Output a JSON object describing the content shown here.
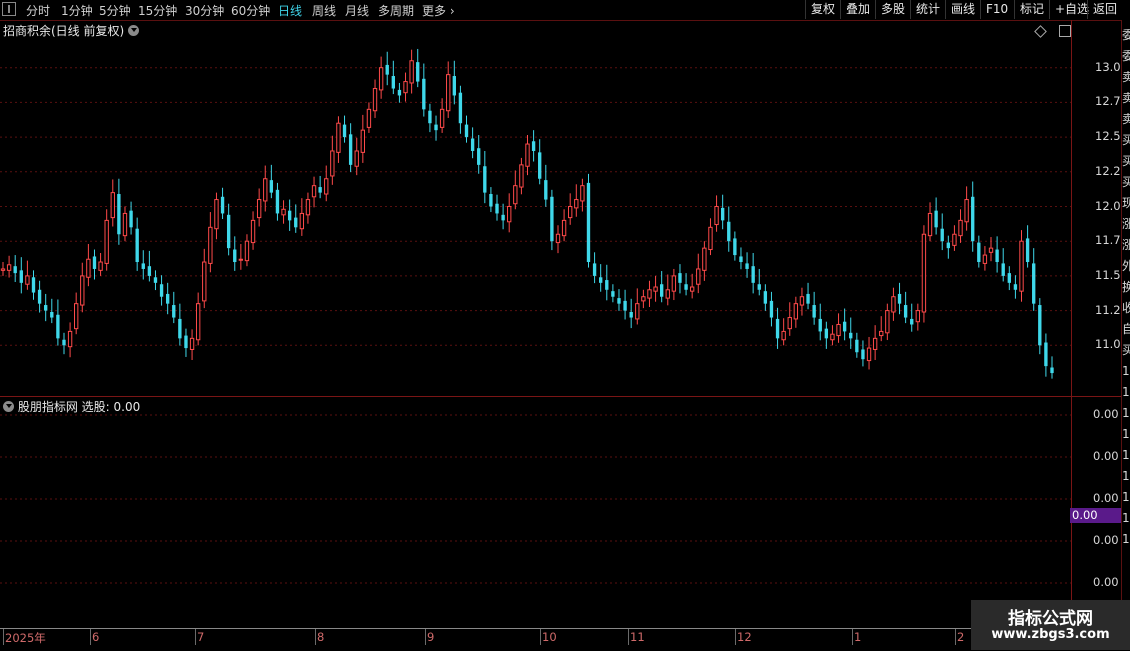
{
  "toolbar": {
    "periods": [
      "分时",
      "1分钟",
      "5分钟",
      "15分钟",
      "30分钟",
      "60分钟",
      "日线",
      "周线",
      "月线",
      "多周期",
      "更多"
    ],
    "active_period": "日线",
    "tools": [
      "复权",
      "叠加",
      "多股",
      "统计",
      "画线",
      "F10",
      "标记",
      "+自选",
      "返回"
    ]
  },
  "main_chart": {
    "title": "招商积余(日线 前复权)",
    "price_ticks": [
      "13.00",
      "12.75",
      "12.50",
      "12.25",
      "12.00",
      "11.75",
      "11.50",
      "11.25",
      "11.00"
    ]
  },
  "indicator": {
    "title": "股朋指标网 选股: 0.00",
    "ticks": [
      "0.00",
      "0.00",
      "0.00",
      "0.00",
      "0.00"
    ],
    "current_value": "0.00"
  },
  "date_axis": {
    "labels": [
      "2025年",
      "6",
      "7",
      "8",
      "9",
      "10",
      "11",
      "12",
      "1",
      "2"
    ]
  },
  "right_strip": {
    "chars": [
      "委",
      "委",
      "卖",
      "卖",
      "卖",
      "买",
      "买",
      "买",
      "现",
      "涨",
      "涨",
      "外",
      "换",
      "收",
      "自",
      "买",
      "1",
      "1",
      "1",
      "1",
      "1",
      "1",
      "1",
      "1",
      "1"
    ]
  },
  "watermark": {
    "title": "指标公式网",
    "url": "www.zbgs3.com"
  },
  "colors": {
    "up": "#ff4a4a",
    "down": "#3fd8ea",
    "grid": "#5a1010",
    "badge": "#5a1a8a"
  },
  "chart_data": {
    "type": "candlestick",
    "y_range": [
      10.75,
      13.25
    ],
    "x_labels": [
      "2025年",
      "6",
      "7",
      "8",
      "9",
      "10",
      "11",
      "12",
      "1",
      "2"
    ],
    "close_series": [
      11.55,
      11.58,
      11.52,
      11.45,
      11.5,
      11.38,
      11.3,
      11.25,
      11.2,
      11.05,
      11.0,
      11.1,
      11.3,
      11.5,
      11.62,
      11.55,
      11.6,
      11.9,
      12.1,
      11.8,
      11.95,
      11.85,
      11.6,
      11.55,
      11.5,
      11.45,
      11.35,
      11.3,
      11.2,
      11.05,
      10.98,
      11.05,
      11.3,
      11.6,
      11.85,
      12.05,
      11.95,
      11.7,
      11.6,
      11.62,
      11.75,
      11.9,
      12.05,
      12.2,
      12.1,
      11.95,
      11.98,
      11.9,
      11.85,
      11.95,
      12.05,
      12.15,
      12.1,
      12.2,
      12.4,
      12.6,
      12.5,
      12.3,
      12.4,
      12.55,
      12.7,
      12.85,
      13.0,
      12.95,
      12.85,
      12.8,
      12.9,
      13.05,
      12.9,
      12.7,
      12.6,
      12.55,
      12.7,
      12.95,
      12.8,
      12.6,
      12.5,
      12.4,
      12.3,
      12.1,
      12.0,
      11.95,
      11.9,
      12.0,
      12.15,
      12.3,
      12.45,
      12.4,
      12.2,
      12.05,
      11.75,
      11.8,
      11.9,
      12.0,
      12.05,
      12.15,
      11.6,
      11.5,
      11.45,
      11.4,
      11.35,
      11.3,
      11.25,
      11.2,
      11.3,
      11.35,
      11.4,
      11.42,
      11.35,
      11.4,
      11.5,
      11.45,
      11.4,
      11.42,
      11.55,
      11.7,
      11.85,
      12.0,
      11.9,
      11.75,
      11.65,
      11.6,
      11.55,
      11.45,
      11.4,
      11.3,
      11.2,
      11.05,
      11.1,
      11.2,
      11.3,
      11.35,
      11.3,
      11.2,
      11.1,
      11.05,
      11.08,
      11.15,
      11.1,
      11.05,
      10.95,
      10.9,
      10.98,
      11.05,
      11.1,
      11.25,
      11.35,
      11.3,
      11.2,
      11.15,
      11.25,
      11.8,
      11.95,
      11.85,
      11.75,
      11.7,
      11.8,
      11.9,
      12.05,
      11.75,
      11.6,
      11.65,
      11.7,
      11.6,
      11.5,
      11.45,
      11.4,
      11.75,
      11.6,
      11.3,
      11.0,
      10.85,
      10.8
    ]
  }
}
